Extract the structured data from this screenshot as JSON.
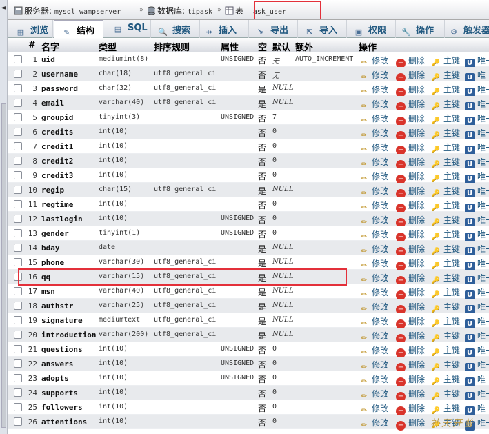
{
  "breadcrumb": {
    "server_label": "服务器:",
    "server_value": "mysql wampserver",
    "db_label": "数据库:",
    "db_value": "tipask",
    "table_label": "表",
    "table_value": "ask_user"
  },
  "tabs": [
    {
      "label": "浏览",
      "icon": "table-icon"
    },
    {
      "label": "结构",
      "icon": "structure-icon"
    },
    {
      "label": "SQL",
      "icon": "sql-icon"
    },
    {
      "label": "搜索",
      "icon": "search-icon"
    },
    {
      "label": "插入",
      "icon": "insert-icon"
    },
    {
      "label": "导出",
      "icon": "export-icon"
    },
    {
      "label": "导入",
      "icon": "import-icon"
    },
    {
      "label": "权限",
      "icon": "privileges-icon"
    },
    {
      "label": "操作",
      "icon": "wrench-icon"
    },
    {
      "label": "触发器",
      "icon": "trigger-icon"
    }
  ],
  "active_tab": "结构",
  "headers": {
    "num": "#",
    "name": "名字",
    "type": "类型",
    "collation": "排序规则",
    "attributes": "属性",
    "null": "空",
    "default": "默认",
    "extra": "额外",
    "action": "操作"
  },
  "actions": {
    "edit": "修改",
    "drop": "删除",
    "primary": "主键",
    "unique": "唯一"
  },
  "rows": [
    {
      "num": "1",
      "name": "uid",
      "type": "mediumint(8)",
      "collation": "",
      "attributes": "UNSIGNED",
      "null": "否",
      "default": "无",
      "default_italic": true,
      "extra": "AUTO_INCREMENT"
    },
    {
      "num": "2",
      "name": "username",
      "type": "char(18)",
      "collation": "utf8_general_ci",
      "attributes": "",
      "null": "否",
      "default": "无",
      "default_italic": true,
      "extra": ""
    },
    {
      "num": "3",
      "name": "password",
      "type": "char(32)",
      "collation": "utf8_general_ci",
      "attributes": "",
      "null": "是",
      "default": "NULL",
      "default_italic": true,
      "extra": ""
    },
    {
      "num": "4",
      "name": "email",
      "type": "varchar(40)",
      "collation": "utf8_general_ci",
      "attributes": "",
      "null": "是",
      "default": "NULL",
      "default_italic": true,
      "extra": ""
    },
    {
      "num": "5",
      "name": "groupid",
      "type": "tinyint(3)",
      "collation": "",
      "attributes": "UNSIGNED",
      "null": "否",
      "default": "7",
      "default_italic": false,
      "extra": ""
    },
    {
      "num": "6",
      "name": "credits",
      "type": "int(10)",
      "collation": "",
      "attributes": "",
      "null": "否",
      "default": "0",
      "default_italic": false,
      "extra": ""
    },
    {
      "num": "7",
      "name": "credit1",
      "type": "int(10)",
      "collation": "",
      "attributes": "",
      "null": "否",
      "default": "0",
      "default_italic": false,
      "extra": ""
    },
    {
      "num": "8",
      "name": "credit2",
      "type": "int(10)",
      "collation": "",
      "attributes": "",
      "null": "否",
      "default": "0",
      "default_italic": false,
      "extra": ""
    },
    {
      "num": "9",
      "name": "credit3",
      "type": "int(10)",
      "collation": "",
      "attributes": "",
      "null": "否",
      "default": "0",
      "default_italic": false,
      "extra": ""
    },
    {
      "num": "10",
      "name": "regip",
      "type": "char(15)",
      "collation": "utf8_general_ci",
      "attributes": "",
      "null": "是",
      "default": "NULL",
      "default_italic": true,
      "extra": ""
    },
    {
      "num": "11",
      "name": "regtime",
      "type": "int(10)",
      "collation": "",
      "attributes": "",
      "null": "否",
      "default": "0",
      "default_italic": false,
      "extra": ""
    },
    {
      "num": "12",
      "name": "lastlogin",
      "type": "int(10)",
      "collation": "",
      "attributes": "UNSIGNED",
      "null": "否",
      "default": "0",
      "default_italic": false,
      "extra": ""
    },
    {
      "num": "13",
      "name": "gender",
      "type": "tinyint(1)",
      "collation": "",
      "attributes": "UNSIGNED",
      "null": "否",
      "default": "0",
      "default_italic": false,
      "extra": ""
    },
    {
      "num": "14",
      "name": "bday",
      "type": "date",
      "collation": "",
      "attributes": "",
      "null": "是",
      "default": "NULL",
      "default_italic": true,
      "extra": ""
    },
    {
      "num": "15",
      "name": "phone",
      "type": "varchar(30)",
      "collation": "utf8_general_ci",
      "attributes": "",
      "null": "是",
      "default": "NULL",
      "default_italic": true,
      "extra": ""
    },
    {
      "num": "16",
      "name": "qq",
      "type": "varchar(15)",
      "collation": "utf8_general_ci",
      "attributes": "",
      "null": "是",
      "default": "NULL",
      "default_italic": true,
      "extra": ""
    },
    {
      "num": "17",
      "name": "msn",
      "type": "varchar(40)",
      "collation": "utf8_general_ci",
      "attributes": "",
      "null": "是",
      "default": "NULL",
      "default_italic": true,
      "extra": ""
    },
    {
      "num": "18",
      "name": "authstr",
      "type": "varchar(25)",
      "collation": "utf8_general_ci",
      "attributes": "",
      "null": "是",
      "default": "NULL",
      "default_italic": true,
      "extra": ""
    },
    {
      "num": "19",
      "name": "signature",
      "type": "mediumtext",
      "collation": "utf8_general_ci",
      "attributes": "",
      "null": "是",
      "default": "NULL",
      "default_italic": true,
      "extra": ""
    },
    {
      "num": "20",
      "name": "introduction",
      "type": "varchar(200)",
      "collation": "utf8_general_ci",
      "attributes": "",
      "null": "是",
      "default": "NULL",
      "default_italic": true,
      "extra": ""
    },
    {
      "num": "21",
      "name": "questions",
      "type": "int(10)",
      "collation": "",
      "attributes": "UNSIGNED",
      "null": "否",
      "default": "0",
      "default_italic": false,
      "extra": ""
    },
    {
      "num": "22",
      "name": "answers",
      "type": "int(10)",
      "collation": "",
      "attributes": "UNSIGNED",
      "null": "否",
      "default": "0",
      "default_italic": false,
      "extra": ""
    },
    {
      "num": "23",
      "name": "adopts",
      "type": "int(10)",
      "collation": "",
      "attributes": "UNSIGNED",
      "null": "否",
      "default": "0",
      "default_italic": false,
      "extra": ""
    },
    {
      "num": "24",
      "name": "supports",
      "type": "int(10)",
      "collation": "",
      "attributes": "",
      "null": "否",
      "default": "0",
      "default_italic": false,
      "extra": ""
    },
    {
      "num": "25",
      "name": "followers",
      "type": "int(10)",
      "collation": "",
      "attributes": "",
      "null": "否",
      "default": "0",
      "default_italic": false,
      "extra": ""
    },
    {
      "num": "26",
      "name": "attentions",
      "type": "int(10)",
      "collation": "",
      "attributes": "",
      "null": "否",
      "default": "0",
      "default_italic": false,
      "extra": ""
    }
  ],
  "watermark": "补天开普",
  "colors": {
    "link": "#235a81",
    "highlight": "#e3303a",
    "row_alt": "#e8eaed"
  }
}
